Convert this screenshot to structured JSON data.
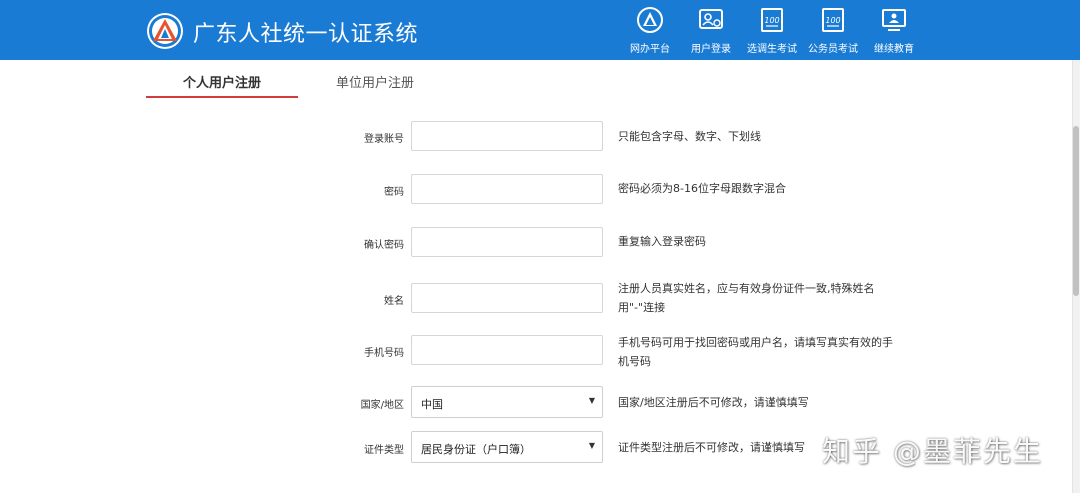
{
  "header": {
    "site_title": "广东人社统一认证系统",
    "nav": [
      {
        "label": "网办平台",
        "icon": "emblem-icon"
      },
      {
        "label": "用户登录",
        "icon": "user-card-icon"
      },
      {
        "label": "选调生考试",
        "icon": "exam-100-icon"
      },
      {
        "label": "公务员考试",
        "icon": "exam-100-icon"
      },
      {
        "label": "继续教育",
        "icon": "education-monitor-icon"
      }
    ]
  },
  "tabs": {
    "personal": "个人用户注册",
    "organization": "单位用户注册"
  },
  "form": {
    "account": {
      "label": "登录账号",
      "hint": "只能包含字母、数字、下划线"
    },
    "password": {
      "label": "密码",
      "hint": "密码必须为8-16位字母跟数字混合"
    },
    "confirm": {
      "label": "确认密码",
      "hint": "重复输入登录密码"
    },
    "name": {
      "label": "姓名",
      "hint_line1": "注册人员真实姓名，应与有效身份证件一致,特殊姓名",
      "hint_line2": "用\"-\"连接"
    },
    "phone": {
      "label": "手机号码",
      "hint_line1": "手机号码可用于找回密码或用户名，请填写真实有效的手",
      "hint_line2": "机号码"
    },
    "country": {
      "label": "国家/地区",
      "value": "中国",
      "hint": "国家/地区注册后不可修改，请谨慎填写"
    },
    "id_type": {
      "label": "证件类型",
      "value": "居民身份证（户口簿）",
      "hint": "证件类型注册后不可修改，请谨慎填写"
    }
  },
  "watermark": "知乎 @墨菲先生",
  "colors": {
    "header_bg": "#1a7bd4",
    "tab_underline": "#d33c3c"
  }
}
